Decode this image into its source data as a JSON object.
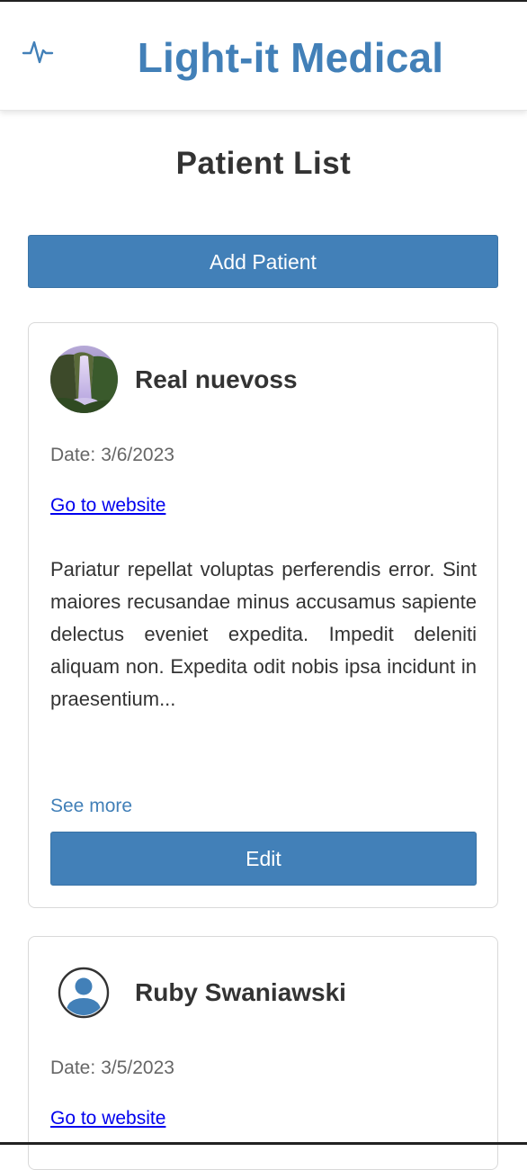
{
  "header": {
    "title": "Light-it Medical",
    "logo_icon": "heartbeat-pulse-icon"
  },
  "page": {
    "title": "Patient List",
    "add_button_label": "Add Patient"
  },
  "colors": {
    "brand": "#4280b8",
    "link": "#0000ee",
    "text": "#333333",
    "muted": "#666666"
  },
  "patients": [
    {
      "name": "Real nuevoss",
      "avatar": "waterfall-photo",
      "date_label": "Date:",
      "date": "3/6/2023",
      "website_label": "Go to website",
      "description": "Pariatur repellat voluptas perferendis error. Sint maiores recusandae minus accusamus sapiente delectus eveniet expedita. Impedit deleniti aliquam non. Expedita odit nobis ipsa incidunt in praesentium...",
      "see_more_label": "See more",
      "edit_label": "Edit"
    },
    {
      "name": "Ruby Swaniawski",
      "avatar": "user-circle-icon",
      "date_label": "Date:",
      "date": "3/5/2023",
      "website_label": "Go to website"
    }
  ]
}
